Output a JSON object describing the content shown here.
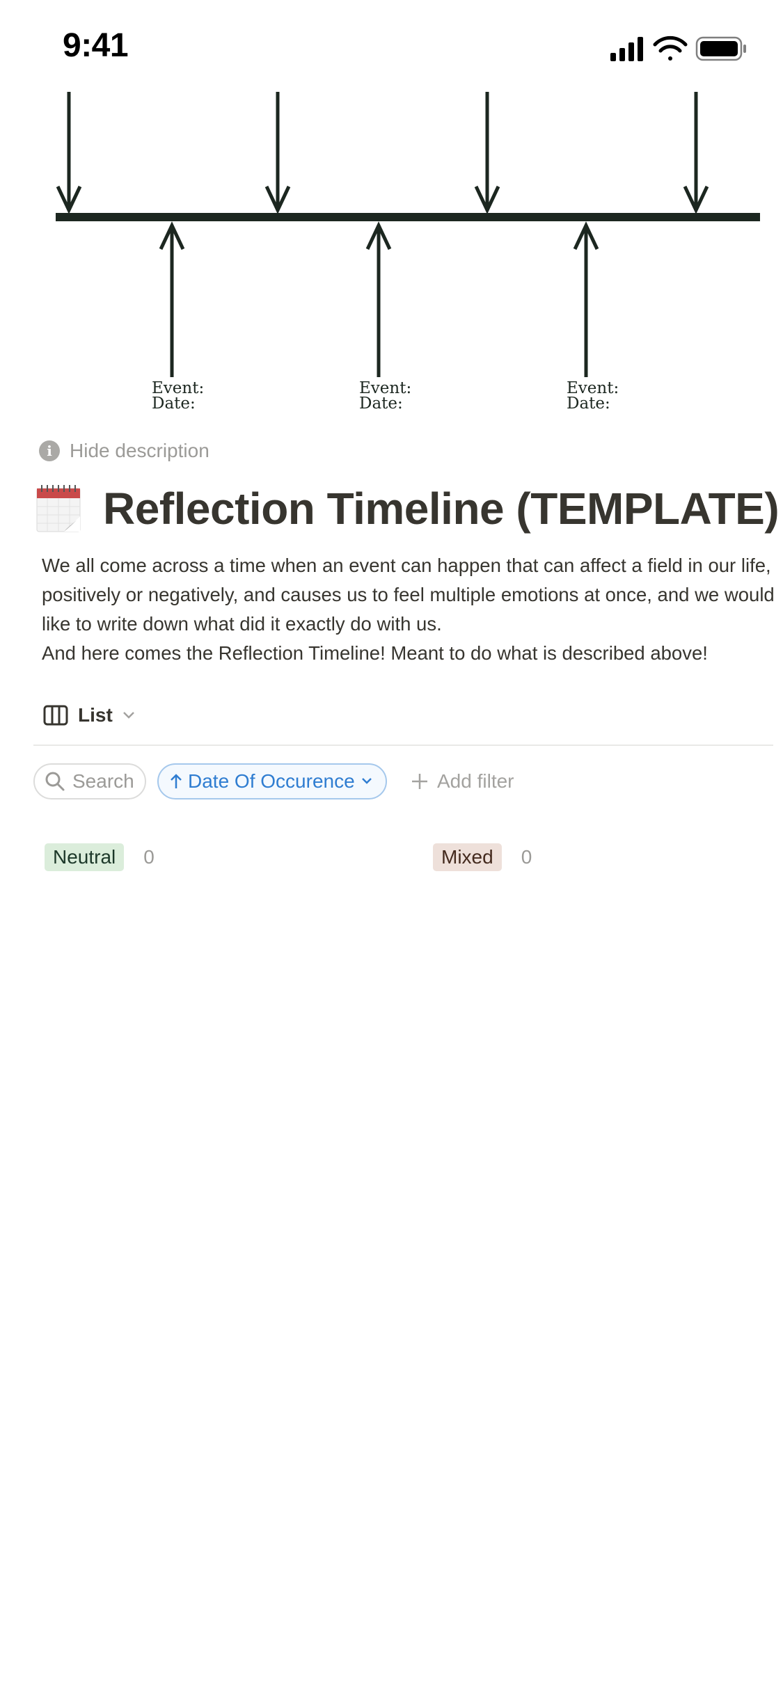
{
  "status_bar": {
    "time": "9:41"
  },
  "cover": {
    "event_labels": [
      "Event:",
      "Event:",
      "Event:"
    ],
    "date_labels": [
      "Date:",
      "Date:",
      "Date:"
    ]
  },
  "description_toggle": {
    "label": "Hide description"
  },
  "page": {
    "icon": "calendar-icon",
    "title": "Reflection Timeline (TEMPLATE)",
    "description_lines": [
      "We all come across a time when an event can happen that can affect a field in our life, positively or negatively, and causes us to feel multiple emotions at once, and we would like to write down what did it exactly do with us.",
      "And here comes the Reflection Timeline! Meant to do what is described above!"
    ]
  },
  "view": {
    "label": "List"
  },
  "toolbar": {
    "search_label": "Search",
    "sort_label": "Date Of Occurence",
    "add_filter_label": "Add filter"
  },
  "groups": [
    {
      "label": "Neutral",
      "count": "0",
      "color": "#dbeddb"
    },
    {
      "label": "Mixed",
      "count": "0",
      "color": "#eee0da"
    }
  ]
}
